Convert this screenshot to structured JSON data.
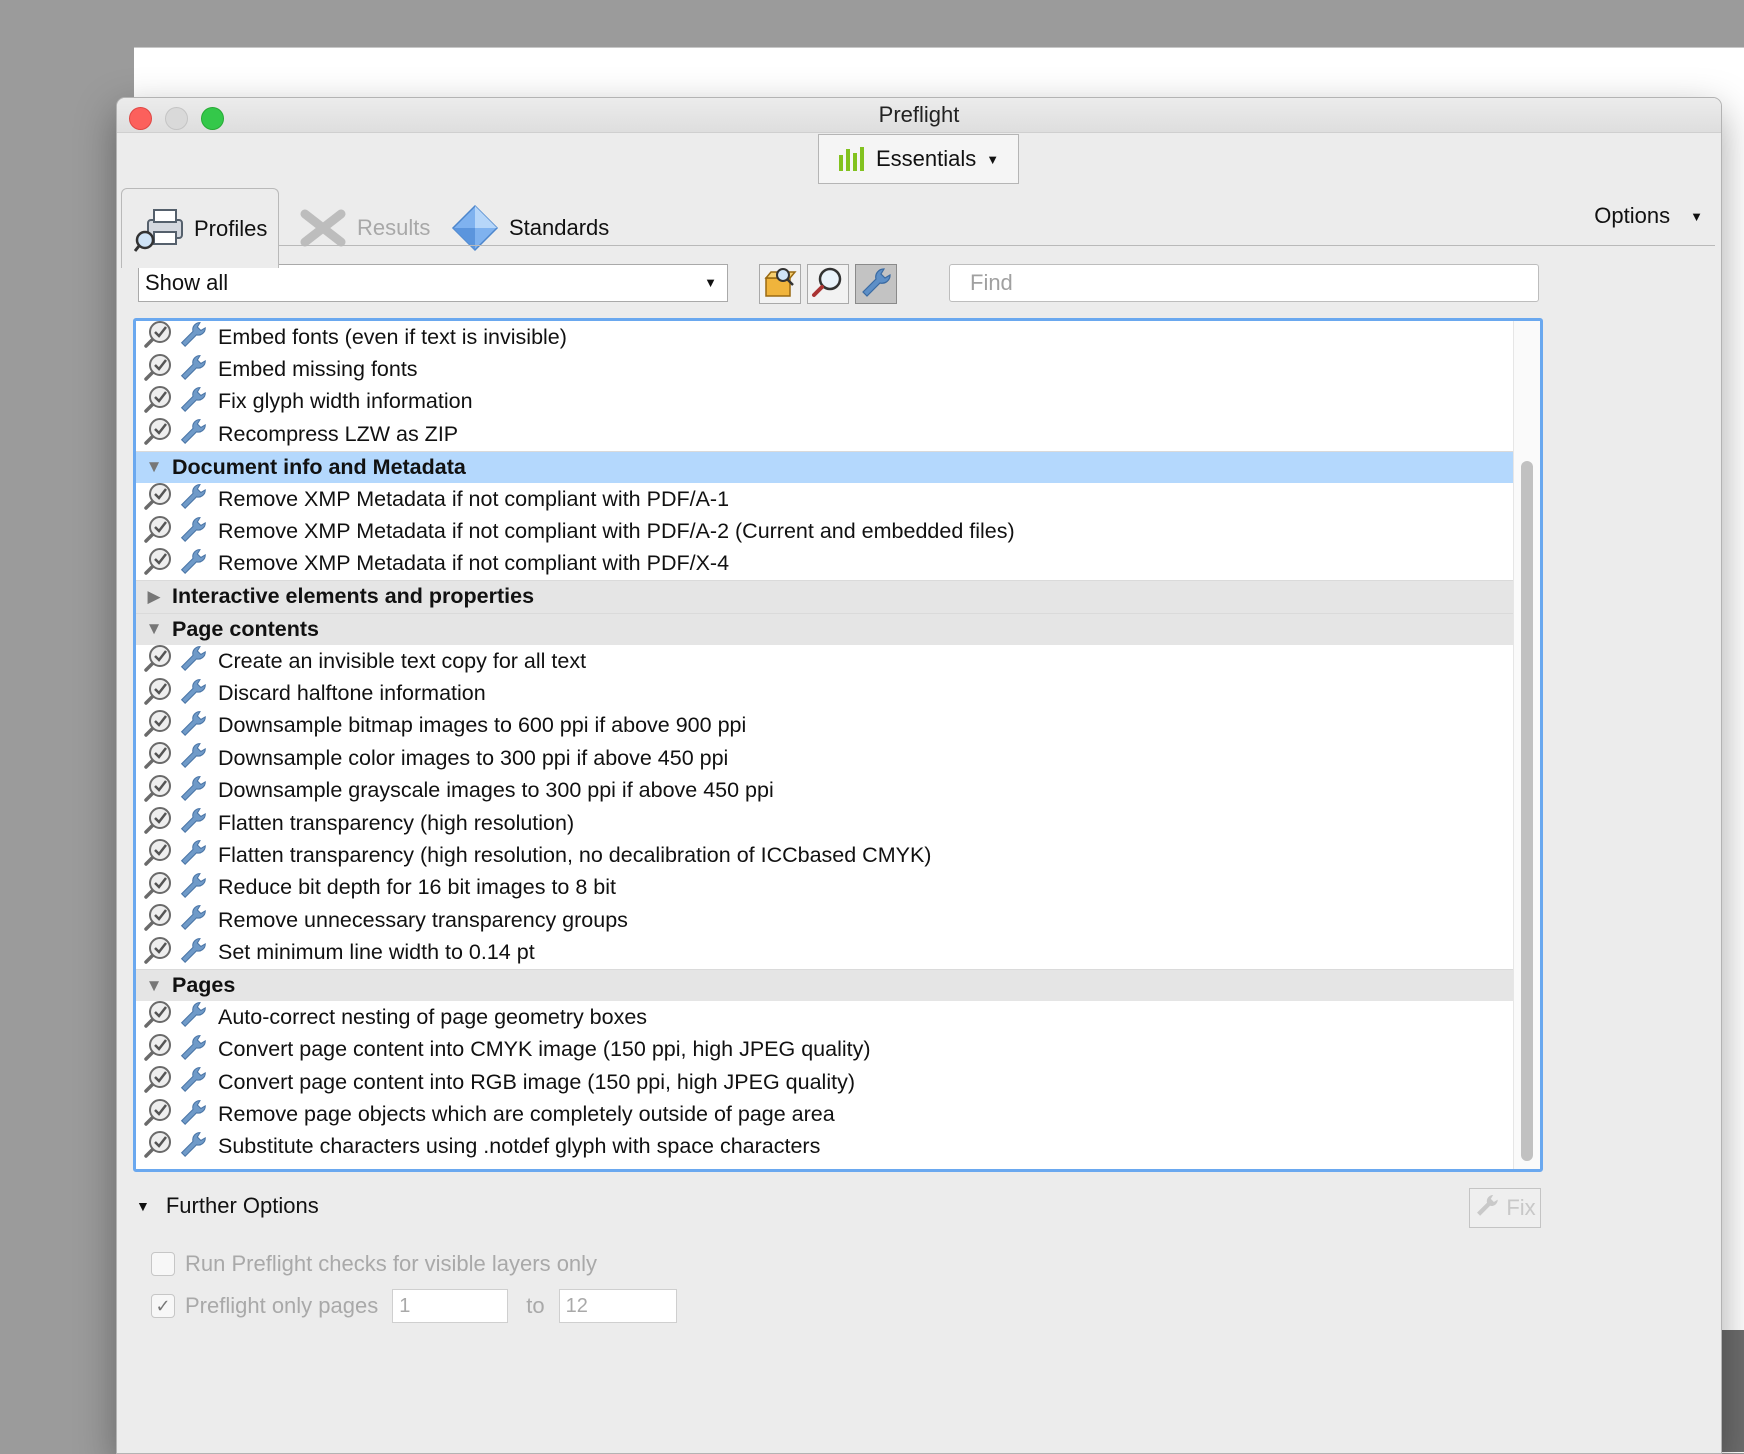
{
  "window": {
    "title": "Preflight"
  },
  "workspace": {
    "label": "Essentials",
    "accent": "#82c21f"
  },
  "tabs": [
    {
      "label": "Profiles",
      "icon": "printer-magnifier-icon",
      "selected": true,
      "enabled": true
    },
    {
      "label": "Results",
      "icon": "results-cross-icon",
      "selected": false,
      "enabled": false
    },
    {
      "label": "Standards",
      "icon": "diamond-icon",
      "selected": false,
      "enabled": true
    }
  ],
  "options": {
    "label": "Options"
  },
  "filter": {
    "value": "Show all"
  },
  "toolbar": {
    "buttons": [
      {
        "icon": "profile-box-icon",
        "active": false
      },
      {
        "icon": "check-magnifier-icon",
        "active": false
      },
      {
        "icon": "wrench-icon",
        "active": true
      }
    ]
  },
  "find": {
    "placeholder": "Find"
  },
  "list": {
    "rows": [
      {
        "type": "item",
        "label": "Embed fonts (even if text is invisible)"
      },
      {
        "type": "item",
        "label": "Embed missing fonts"
      },
      {
        "type": "item",
        "label": "Fix glyph width information"
      },
      {
        "type": "item",
        "label": "Recompress LZW as ZIP"
      },
      {
        "type": "group",
        "label": "Document info and Metadata",
        "expanded": true,
        "selected": true
      },
      {
        "type": "item",
        "label": "Remove XMP Metadata if not compliant with PDF/A-1"
      },
      {
        "type": "item",
        "label": "Remove XMP Metadata if not compliant with PDF/A-2 (Current and embedded files)"
      },
      {
        "type": "item",
        "label": "Remove XMP Metadata if not compliant with PDF/X-4"
      },
      {
        "type": "group",
        "label": "Interactive elements and properties",
        "expanded": false,
        "selected": false
      },
      {
        "type": "group",
        "label": "Page contents",
        "expanded": true,
        "selected": false
      },
      {
        "type": "item",
        "label": "Create an invisible text copy for all text"
      },
      {
        "type": "item",
        "label": "Discard halftone information"
      },
      {
        "type": "item",
        "label": "Downsample bitmap images to 600 ppi if above 900 ppi"
      },
      {
        "type": "item",
        "label": "Downsample color images to 300 ppi if above 450 ppi"
      },
      {
        "type": "item",
        "label": "Downsample grayscale images to 300 ppi if above 450 ppi"
      },
      {
        "type": "item",
        "label": "Flatten transparency (high resolution)"
      },
      {
        "type": "item",
        "label": "Flatten transparency (high resolution, no decalibration of ICCbased CMYK)"
      },
      {
        "type": "item",
        "label": "Reduce bit depth for 16 bit images to 8 bit"
      },
      {
        "type": "item",
        "label": "Remove unnecessary transparency groups"
      },
      {
        "type": "item",
        "label": "Set minimum line width to 0.14 pt"
      },
      {
        "type": "group",
        "label": "Pages",
        "expanded": true,
        "selected": false
      },
      {
        "type": "item",
        "label": "Auto-correct nesting of page geometry boxes"
      },
      {
        "type": "item",
        "label": "Convert page content into CMYK image (150 ppi, high JPEG quality)"
      },
      {
        "type": "item",
        "label": "Convert page content into RGB image (150 ppi, high JPEG quality)"
      },
      {
        "type": "item",
        "label": "Remove page objects which are completely outside of page area"
      },
      {
        "type": "item",
        "label": "Substitute characters using .notdef glyph with space characters"
      }
    ]
  },
  "further_options": {
    "label": "Further Options",
    "fix_label": "Fix",
    "visible_layers": {
      "label": "Run Preflight checks for visible layers only",
      "checked": false
    },
    "pages_only": {
      "label": "Preflight only pages",
      "checked": true,
      "from": "1",
      "to_label": "to",
      "to": "12"
    }
  },
  "colors": {
    "selection": "#b4d8fd",
    "focus_ring": "#6aa8ef",
    "group_bg": "#e5e5e5"
  }
}
